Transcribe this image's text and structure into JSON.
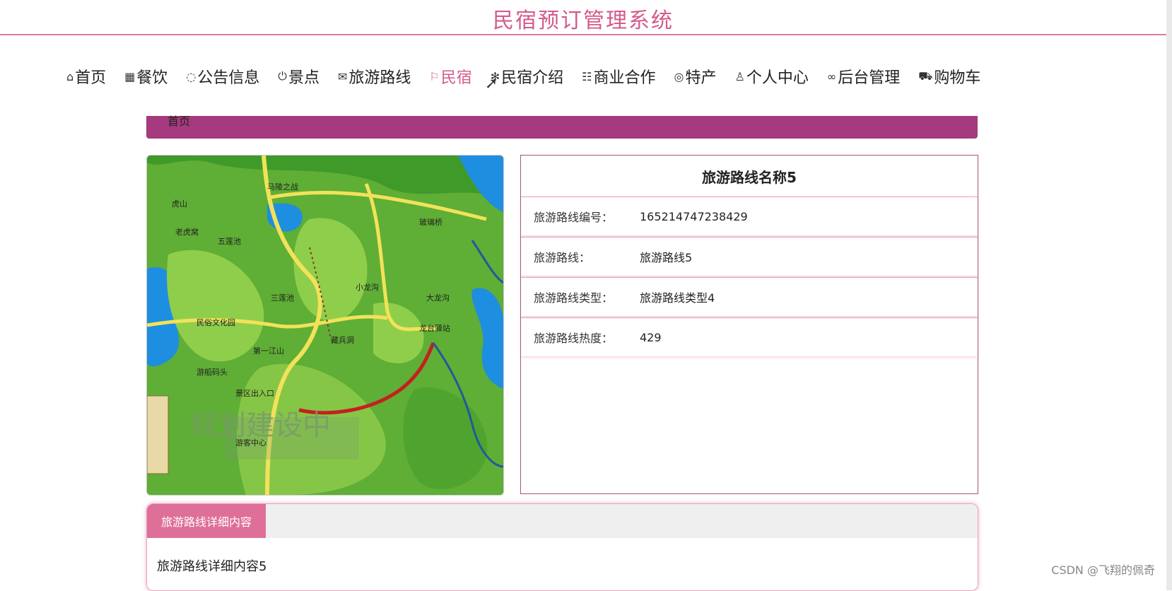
{
  "app": {
    "title": "民宿预订管理系统"
  },
  "nav": [
    {
      "icon": "home-icon",
      "glyph": "⌂",
      "label": "首页"
    },
    {
      "icon": "grid-icon",
      "glyph": "▦",
      "label": "餐饮"
    },
    {
      "icon": "chat-icon",
      "glyph": "◌",
      "label": "公告信息"
    },
    {
      "icon": "power-icon",
      "glyph": "⏻",
      "label": "景点"
    },
    {
      "icon": "mail-icon",
      "glyph": "✉",
      "label": "旅游路线"
    },
    {
      "icon": "flag-icon",
      "glyph": "⚐",
      "label": "民宿"
    },
    {
      "icon": "snowflake-icon",
      "glyph": "✻",
      "label": "民宿介绍"
    },
    {
      "icon": "list-icon",
      "glyph": "☷",
      "label": "商业合作"
    },
    {
      "icon": "globe-icon",
      "glyph": "◎",
      "label": "特产"
    },
    {
      "icon": "user-icon",
      "glyph": "♙",
      "label": "个人中心"
    },
    {
      "icon": "link-icon",
      "glyph": "∞",
      "label": "后台管理"
    },
    {
      "icon": "cart-icon",
      "glyph": "⛟",
      "label": "购物车"
    }
  ],
  "breadcrumb": {
    "text": "首页"
  },
  "map": {
    "overlay_text": "规划建设中",
    "labels": [
      "马陵之战",
      "虎山",
      "老虎窝",
      "五莲池",
      "第一江山",
      "景区出入口",
      "藏兵洞",
      "三莲池",
      "龙台驿站",
      "小龙沟",
      "大龙沟",
      "玻璃桥",
      "民俗文化园",
      "游船码头",
      "游客中心"
    ]
  },
  "detail": {
    "title": "旅游路线名称5",
    "rows": [
      {
        "label": "旅游路线编号：",
        "value": "165214747238429"
      },
      {
        "label": "旅游路线：",
        "value": "旅游路线5"
      },
      {
        "label": "旅游路线类型：",
        "value": "旅游路线类型4"
      },
      {
        "label": "旅游路线热度：",
        "value": "429"
      }
    ]
  },
  "content": {
    "tab_label": "旅游路线详细内容",
    "body": "旅游路线详细内容5"
  },
  "watermark": "CSDN @飞翔的佩奇"
}
